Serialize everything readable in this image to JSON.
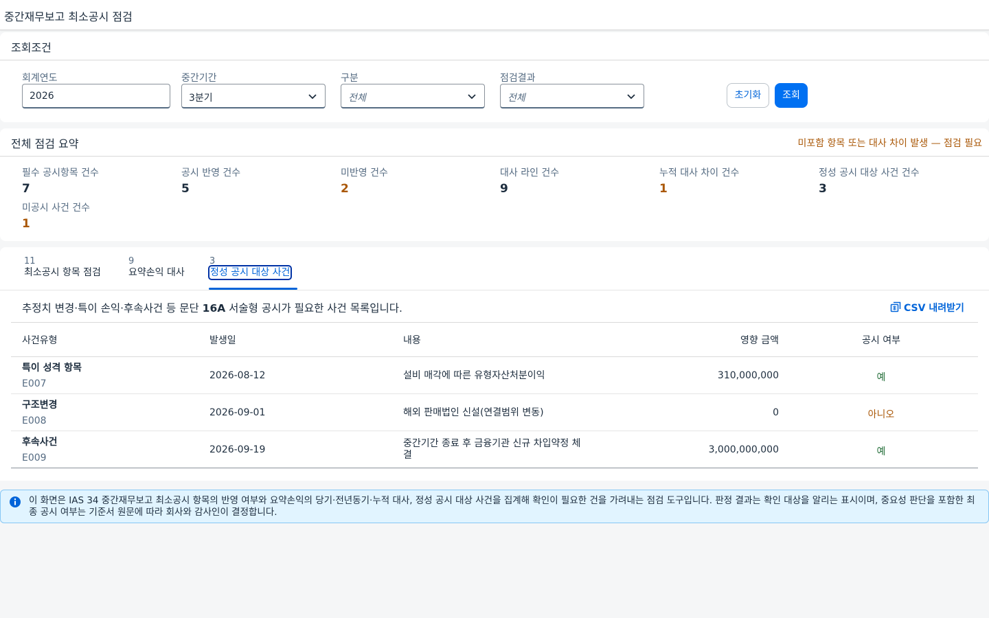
{
  "shell": {
    "title": "중간재무보고 최소공시 점검"
  },
  "filter": {
    "title": "조회조건",
    "fields": [
      {
        "label": "회계연도",
        "value": "2026",
        "placeholder": false
      },
      {
        "label": "중간기간",
        "value": "3분기",
        "placeholder": false
      },
      {
        "label": "구분",
        "value": "전체",
        "placeholder": true
      },
      {
        "label": "점검결과",
        "value": "전체",
        "placeholder": true
      }
    ],
    "reset_label": "초기화",
    "search_label": "조회"
  },
  "summary": {
    "title": "전체 점검 요약",
    "warning": "미포함 항목 또는 대사 차이 발생 — 점검 필요",
    "stats": [
      {
        "label": "필수 공시항목 건수",
        "value": "7",
        "warn": false
      },
      {
        "label": "공시 반영 건수",
        "value": "5",
        "warn": false
      },
      {
        "label": "미반영 건수",
        "value": "2",
        "warn": true
      },
      {
        "label": "대사 라인 건수",
        "value": "9",
        "warn": false
      },
      {
        "label": "누적 대사 차이 건수",
        "value": "1",
        "warn": true
      },
      {
        "label": "정성 공시 대상 사건 건수",
        "value": "3",
        "warn": false
      },
      {
        "label": "미공시 사건 건수",
        "value": "1",
        "warn": true
      }
    ]
  },
  "tabs": [
    {
      "count": "11",
      "label": "최소공시 항목 점검",
      "selected": false
    },
    {
      "count": "9",
      "label": "요약손익 대사",
      "selected": false
    },
    {
      "count": "3",
      "label": "정성 공시 대상 사건",
      "selected": true
    }
  ],
  "events": {
    "desc_pre": "추정치 변경·특이 손익·후속사건 등 문단 ",
    "desc_bold": "16A",
    "desc_post": " 서술형 공시가 필요한 사건 목록입니다.",
    "csv_label": "CSV 내려받기",
    "columns": [
      "사건유형",
      "발생일",
      "내용",
      "영향 금액",
      "공시 여부"
    ],
    "rows": [
      {
        "type": "특이 성격 항목",
        "id": "E007",
        "date": "2026-08-12",
        "content": "설비 매각에 따른 유형자산처분이익",
        "amount": "310,000,000",
        "disclosed": "예",
        "status": "yes"
      },
      {
        "type": "구조변경",
        "id": "E008",
        "date": "2026-09-01",
        "content": "해외 판매법인 신설(연결범위 변동)",
        "amount": "0",
        "disclosed": "아니오",
        "status": "no"
      },
      {
        "type": "후속사건",
        "id": "E009",
        "date": "2026-09-19",
        "content": "중간기간 종료 후 금융기관 신규 차입약정 체결",
        "amount": "3,000,000,000",
        "disclosed": "예",
        "status": "yes"
      }
    ]
  },
  "info_message": "이 화면은 IAS 34 중간재무보고 최소공시 항목의 반영 여부와 요약손익의 당기·전년동기·누적 대사, 정성 공시 대상 사건을 집계해 확인이 필요한 건을 가려내는 점검 도구입니다. 판정 결과는 확인 대상을 알리는 표시이며, 중요성 판단을 포함한 최종 공시 여부는 기준서 원문에 따라 회사와 감사인이 결정합니다.",
  "colors": {
    "accent": "#0070f2",
    "warning": "#aa5808",
    "positive": "#256f3a",
    "info_bg": "#e1f4ff"
  },
  "icons": [
    "chevron-down-icon",
    "csv-export-icon",
    "info-icon"
  ]
}
